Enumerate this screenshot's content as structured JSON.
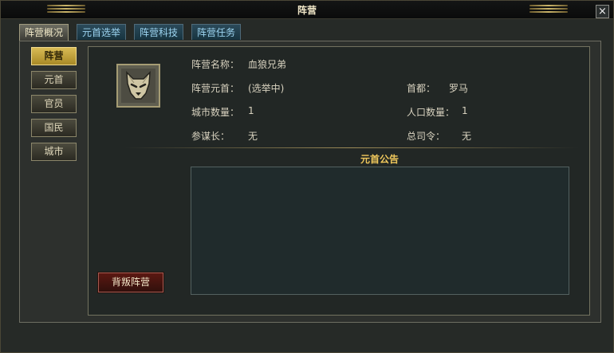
{
  "window": {
    "title": "阵营",
    "close_label": "×"
  },
  "tabs": [
    {
      "label": "阵营概况",
      "active": true
    },
    {
      "label": "元首选举",
      "active": false
    },
    {
      "label": "阵营科技",
      "active": false
    },
    {
      "label": "阵营任务",
      "active": false
    }
  ],
  "sidebar": {
    "items": [
      {
        "label": "阵营",
        "active": true
      },
      {
        "label": "元首",
        "active": false
      },
      {
        "label": "官员",
        "active": false
      },
      {
        "label": "国民",
        "active": false
      },
      {
        "label": "城市",
        "active": false
      }
    ]
  },
  "info": {
    "name_label": "阵营名称：",
    "name_value": "血狼兄弟",
    "leader_label": "阵营元首：",
    "leader_value": "(选举中)",
    "capital_label": "首都：",
    "capital_value": "罗马",
    "cities_label": "城市数量：",
    "cities_value": "1",
    "population_label": "人口数量：",
    "population_value": "1",
    "chief_of_staff_label": "参谋长：",
    "chief_of_staff_value": "无",
    "commander_label": "总司令：",
    "commander_value": "无"
  },
  "notice": {
    "title": "元首公告",
    "content": ""
  },
  "actions": {
    "betray_label": "背叛阵营"
  },
  "colors": {
    "accent_gold": "#f0c85c",
    "tab_text": "#9bd3ef",
    "danger": "#5b1812"
  }
}
